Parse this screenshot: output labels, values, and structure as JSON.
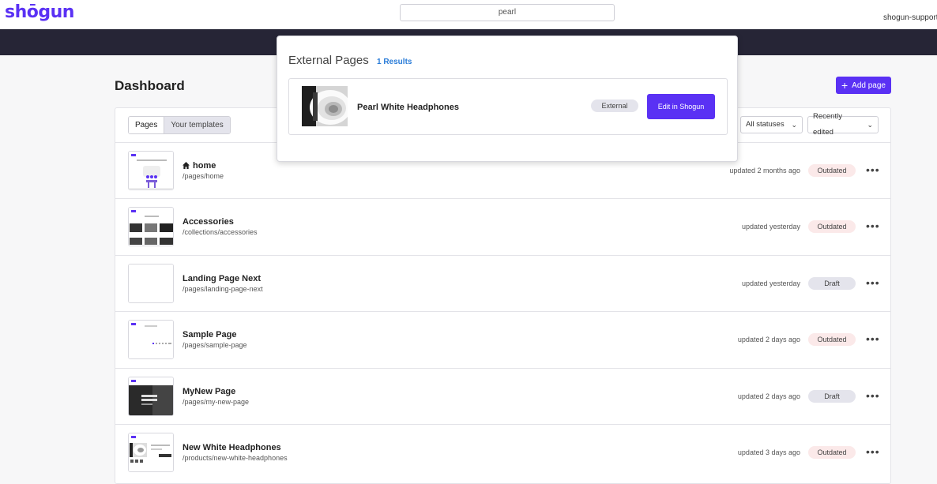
{
  "header": {
    "logo": "shōgun",
    "search_value": "pearl",
    "account": "shogun-support."
  },
  "dashboard": {
    "title": "Dashboard",
    "add_page_label": "Add page",
    "tabs": [
      {
        "label": "Pages",
        "active": true
      },
      {
        "label": "Your templates",
        "active": false
      }
    ],
    "status_filter": "All statuses",
    "sort": "Recently edited",
    "pages": [
      {
        "title": "home",
        "path": "/pages/home",
        "updated": "updated 2 months ago",
        "status": "Outdated",
        "is_home": true,
        "thumb": "home"
      },
      {
        "title": "Accessories",
        "path": "/collections/accessories",
        "updated": "updated yesterday",
        "status": "Outdated",
        "thumb": "grid"
      },
      {
        "title": "Landing Page Next",
        "path": "/pages/landing-page-next",
        "updated": "updated yesterday",
        "status": "Draft",
        "thumb": "blank"
      },
      {
        "title": "Sample Page",
        "path": "/pages/sample-page",
        "updated": "updated 2 days ago",
        "status": "Outdated",
        "thumb": "sample"
      },
      {
        "title": "MyNew Page",
        "path": "/pages/my-new-page",
        "updated": "updated 2 days ago",
        "status": "Draft",
        "thumb": "dark"
      },
      {
        "title": "New White Headphones",
        "path": "/products/new-white-headphones",
        "updated": "updated 3 days ago",
        "status": "Outdated",
        "thumb": "product"
      }
    ]
  },
  "search_popup": {
    "title": "External Pages",
    "count": "1 Results",
    "result": {
      "name": "Pearl White Headphones",
      "badge": "External",
      "action": "Edit in Shogun"
    }
  },
  "colors": {
    "brand": "#5a31f4",
    "dark_bar": "#262536",
    "outdated_bg": "#fbe9e9",
    "draft_bg": "#e4e4ec",
    "link_blue": "#2a7cd8"
  }
}
